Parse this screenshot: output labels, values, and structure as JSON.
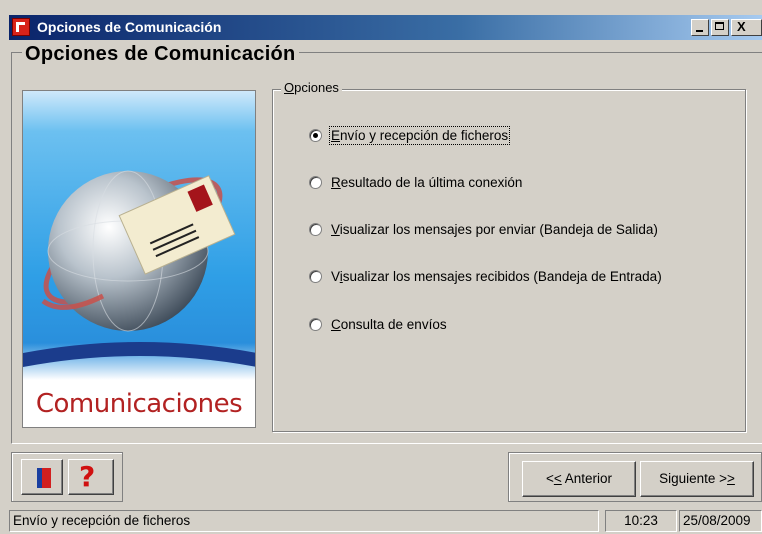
{
  "window": {
    "title": "Opciones de Comunicación",
    "controls": {
      "minimize": "_",
      "maximize": "□",
      "close": "X"
    }
  },
  "main": {
    "heading": "Opciones de Comunicación",
    "banner": {
      "caption": "Comunicaciones",
      "caption_color": "#b22222"
    }
  },
  "options": {
    "legend_first": "O",
    "legend_rest": "pciones",
    "items": [
      {
        "acc": "E",
        "rest": "nvío y recepción de ficheros",
        "checked": true
      },
      {
        "acc": "R",
        "rest": "esultado de la última conexión",
        "checked": false
      },
      {
        "acc": "V",
        "rest": "isualizar los mensajes por enviar (Bandeja de Salida)",
        "checked": false
      },
      {
        "pre": "V",
        "acc": "i",
        "rest": "sualizar los mensajes recibidos (Bandeja de Entrada)",
        "checked": false
      },
      {
        "acc": "C",
        "rest": "onsulta de envíos",
        "checked": false
      }
    ]
  },
  "footer": {
    "help_glyph": "?",
    "prev_pre": "<",
    "prev_acc": "<",
    "prev_rest": " Anterior",
    "next_pre": "Siguiente >",
    "next_acc": ">"
  },
  "statusbar": {
    "message": "Envío y recepción de ficheros",
    "time": "10:23",
    "date": "25/08/2009"
  },
  "colors": {
    "titlebar_start": "#0a246a",
    "face": "#d4d0c8",
    "help_red": "#d01010"
  }
}
